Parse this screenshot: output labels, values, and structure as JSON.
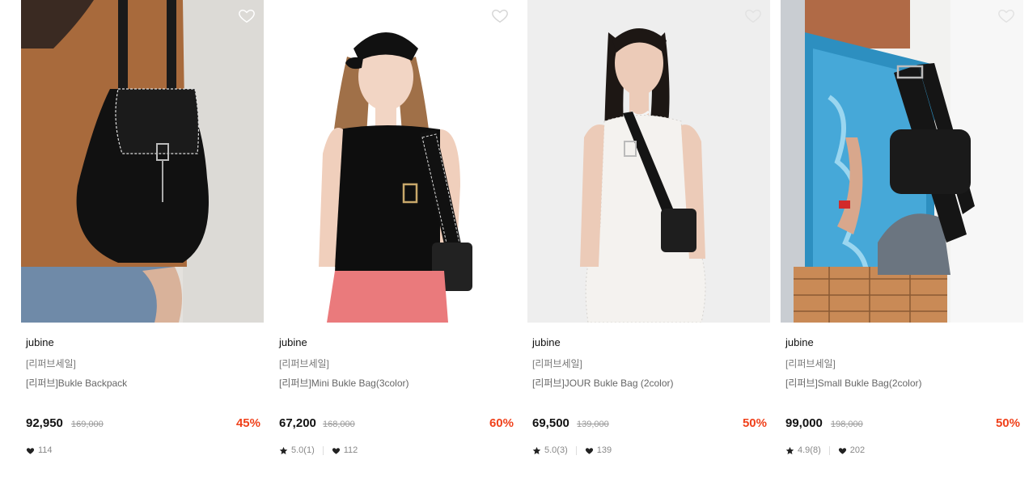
{
  "products": [
    {
      "brand": "jubine",
      "tag": "[리퍼브세일]",
      "name": "[리퍼브]Bukle Backpack",
      "price": "92,950",
      "original_price": "169,000",
      "discount": "45%",
      "rating": "",
      "likes": "114"
    },
    {
      "brand": "jubine",
      "tag": "[리퍼브세일]",
      "name": "[리퍼브]Mini Bukle Bag(3color)",
      "price": "67,200",
      "original_price": "168,000",
      "discount": "60%",
      "rating": "5.0(1)",
      "likes": "112"
    },
    {
      "brand": "jubine",
      "tag": "[리퍼브세일]",
      "name": "[리퍼브]JOUR Bukle Bag (2color)",
      "price": "69,500",
      "original_price": "139,000",
      "discount": "50%",
      "rating": "5.0(3)",
      "likes": "139"
    },
    {
      "brand": "jubine",
      "tag": "[리퍼브세일]",
      "name": "[리퍼브]Small Bukle Bag(2color)",
      "price": "99,000",
      "original_price": "198,000",
      "discount": "50%",
      "rating": "4.9(8)",
      "likes": "202"
    }
  ],
  "icons": {
    "wishlist": "heart-outline-icon",
    "rating": "star-icon",
    "likes": "heart-icon"
  },
  "colors": {
    "discount": "#f0411b",
    "price": "#111111",
    "meta": "#888888"
  }
}
